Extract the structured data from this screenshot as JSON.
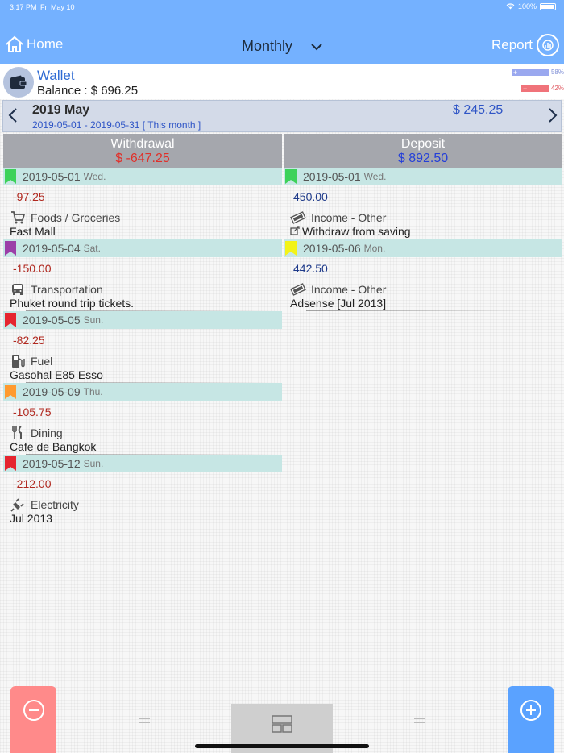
{
  "status": {
    "time": "3:17 PM",
    "date": "Fri May 10",
    "battery": "100%"
  },
  "nav": {
    "home": "Home",
    "period": "Monthly",
    "report": "Report"
  },
  "wallet": {
    "name": "Wallet",
    "balance": "Balance : $ 696.25",
    "income_pct": "58%",
    "expense_pct": "42%",
    "income_fraction": 0.58,
    "expense_fraction": 0.42
  },
  "month": {
    "title": "2019 May",
    "range": "2019-05-01 - 2019-05-31 [ This month ]",
    "total": "$ 245.25"
  },
  "withdrawal": {
    "header": "Withdrawal",
    "total": "$ -647.25",
    "groups": [
      {
        "date": "2019-05-01",
        "weekday": "Wed.",
        "flag": "#3dd25a",
        "entries": [
          {
            "amount": "-97.25",
            "icon": "cart-icon",
            "category": "Foods / Groceries",
            "note": "Fast Mall"
          }
        ]
      },
      {
        "date": "2019-05-04",
        "weekday": "Sat.",
        "flag": "#9b3fa8",
        "entries": [
          {
            "amount": "-150.00",
            "icon": "bus-icon",
            "category": "Transportation",
            "note": "Phuket round trip tickets."
          }
        ]
      },
      {
        "date": "2019-05-05",
        "weekday": "Sun.",
        "flag": "#e5252f",
        "entries": [
          {
            "amount": "-82.25",
            "icon": "fuel-icon",
            "category": "Fuel",
            "note": "Gasohal E85 Esso"
          }
        ]
      },
      {
        "date": "2019-05-09",
        "weekday": "Thu.",
        "flag": "#ff9a2e",
        "entries": [
          {
            "amount": "-105.75",
            "icon": "dining-icon",
            "category": "Dining",
            "note": "Cafe de Bangkok"
          }
        ]
      },
      {
        "date": "2019-05-12",
        "weekday": "Sun.",
        "flag": "#e5252f",
        "entries": [
          {
            "amount": "-212.00",
            "icon": "plug-icon",
            "category": "Electricity",
            "note": "Jul 2013"
          }
        ]
      }
    ]
  },
  "deposit": {
    "header": "Deposit",
    "total": "$ 892.50",
    "groups": [
      {
        "date": "2019-05-01",
        "weekday": "Wed.",
        "flag": "#3dd25a",
        "entries": [
          {
            "amount": "450.00",
            "icon": "money-icon",
            "category": "Income - Other",
            "note": "Withdraw from saving",
            "note_icon": "transfer-icon"
          }
        ]
      },
      {
        "date": "2019-05-06",
        "weekday": "Mon.",
        "flag": "#f3f318",
        "entries": [
          {
            "amount": "442.50",
            "icon": "money-icon",
            "category": "Income - Other",
            "note": "Adsense [Jul 2013]"
          }
        ]
      }
    ]
  },
  "colors": {
    "nav": "#74b1ff",
    "minus": "#ff8a8a",
    "plus": "#5aa2ff",
    "negative": "#b0281f",
    "positive": "#1e3a8a"
  }
}
